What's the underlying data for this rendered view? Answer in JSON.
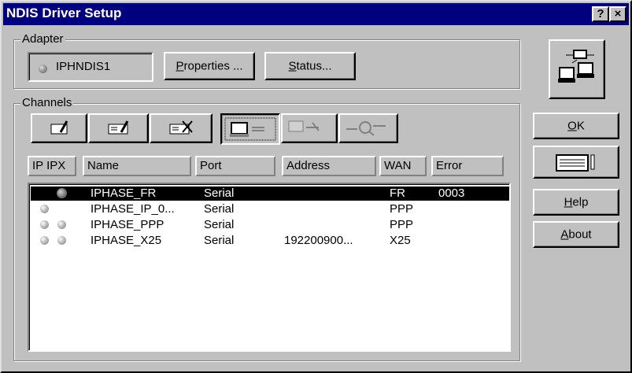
{
  "window": {
    "title": "NDIS Driver Setup",
    "help_btn": "?",
    "close_btn": "×"
  },
  "adapter": {
    "group_label": "Adapter",
    "name": "IPHNDIS1",
    "properties_label": "Properties ...",
    "properties_ul": "P",
    "properties_rest": "roperties ...",
    "status_ul": "S",
    "status_rest": "tatus..."
  },
  "channels": {
    "group_label": "Channels",
    "toolbar_icons": [
      "add-channel-icon",
      "edit-channel-icon",
      "delete-channel-icon",
      "connect-icon",
      "disconnect-icon",
      "monitor-icon"
    ],
    "columns": [
      "IP IPX",
      "Name",
      "Port",
      "Address",
      "WAN",
      "Error"
    ],
    "rows": [
      {
        "ip": "",
        "ipx": "active",
        "name": "IPHASE_FR",
        "port": "Serial",
        "address": "",
        "wan": "FR",
        "error": "0003",
        "selected": true
      },
      {
        "ip": "on",
        "ipx": "",
        "name": "IPHASE_IP_0...",
        "port": "Serial",
        "address": "",
        "wan": "PPP",
        "error": "",
        "selected": false
      },
      {
        "ip": "on",
        "ipx": "on",
        "name": "IPHASE_PPP",
        "port": "Serial",
        "address": "",
        "wan": "PPP",
        "error": "",
        "selected": false
      },
      {
        "ip": "on",
        "ipx": "on",
        "name": "IPHASE_X25",
        "port": "Serial",
        "address": "192200900...",
        "wan": "X25",
        "error": "",
        "selected": false
      }
    ]
  },
  "side": {
    "ok_ul": "O",
    "ok_rest": "K",
    "help_ul": "H",
    "help_rest": "elp",
    "about_ul": "A",
    "about_rest": "bout",
    "network_icon": "network-computers-icon",
    "config_icon": "configuration-icon"
  },
  "colors": {
    "titlebar": "#000080",
    "face": "#c0c0c0",
    "selection": "#000000"
  }
}
